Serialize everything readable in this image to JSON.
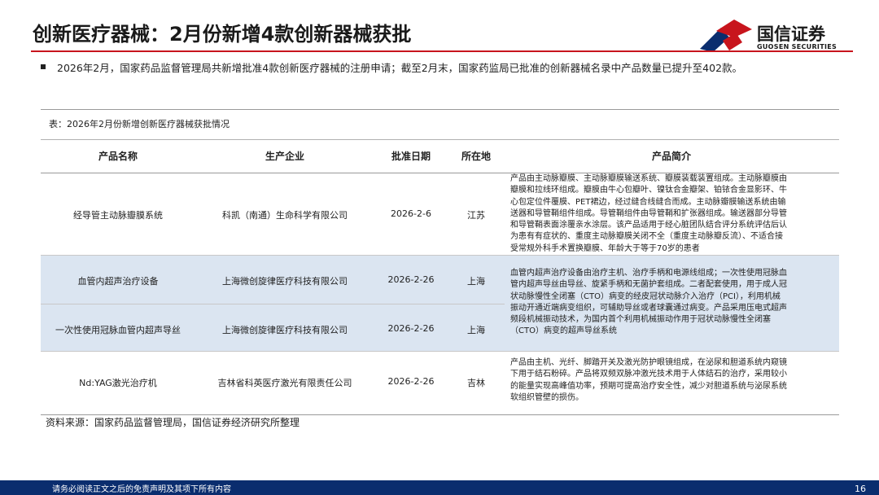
{
  "header": {
    "title": "创新医疗器械：2月份新增4款创新器械获批",
    "logo_cn": "国信证券",
    "logo_en": "GUOSEN SECURITIES",
    "accent_color": "#c8151d"
  },
  "bullet": "2026年2月，国家药品监督管理局共新增批准4款创新医疗器械的注册申请；截至2月末，国家药监局已批准的创新器械名录中产品数量已提升至402款。",
  "table": {
    "caption": "表：2026年2月份新增创新医疗器械获批情况",
    "headers": [
      "产品名称",
      "生产企业",
      "批准日期",
      "所在地",
      "产品简介"
    ],
    "rows": [
      {
        "name": "经导管主动脉瓣膜系统",
        "company": "科凯（南通）生命科学有限公司",
        "date": "2026-2-6",
        "location": "江苏"
      },
      {
        "name": "血管内超声治疗设备",
        "company": "上海微创旋律医疗科技有限公司",
        "date": "2026-2-26",
        "location": "上海"
      },
      {
        "name": "一次性使用冠脉血管内超声导丝",
        "company": "上海微创旋律医疗科技有限公司",
        "date": "2026-2-26",
        "location": "上海"
      },
      {
        "name": "Nd:YAG激光治疗机",
        "company": "吉林省科英医疗激光有限责任公司",
        "date": "2026-2-26",
        "location": "吉林"
      }
    ],
    "descriptions": [
      [
        "产品由主动脉瓣膜、主动脉瓣膜输送系统、瓣膜装载装置组成。主动脉瓣膜由",
        "瓣膜和拉线环组成。瓣膜由牛心包瓣叶、镍钛合金瓣架、铂铱合金显影环、牛",
        "心包定位件覆膜、PET裙边，经过缝合线缝合而成。主动脉瓣膜输送系统由输",
        "送器和导管鞘组件组成。导管鞘组件由导管鞘和扩张器组成。输送器部分导管",
        "和导管鞘表面涂覆亲水涂层。该产品适用于经心脏团队结合评分系统评估后认",
        "为患有有症状的、重度主动脉瓣膜关闭不全（重度主动脉瓣反流）、不适合接",
        "受常规外科手术置换瓣膜、年龄大于等于70岁的患者"
      ],
      [
        "血管内超声治疗设备由治疗主机、治疗手柄和电源线组成；一次性使用冠脉血",
        "管内超声导丝由导丝、旋紧手柄和无菌护套组成。二者配套使用，用于成人冠",
        "状动脉慢性全闭塞（CTO）病变的经皮冠状动脉介入治疗（PCI），利用机械",
        "振动开通近端病变组织，可辅助导丝或者球囊通过病变。产品采用压电式超声",
        "频段机械振动技术，为国内首个利用机械振动作用于冠状动脉慢性全闭塞",
        "（CTO）病变的超声导丝系统"
      ],
      [
        "产品由主机、光纤、脚踏开关及激光防护眼镜组成，在泌尿和胆道系统内窥镜",
        "下用于结石粉碎。产品将双频双脉冲激光技术用于人体结石的治疗，采用较小",
        "的能量实现高峰值功率，预期可提高治疗安全性，减少对胆道系统与泌尿系统",
        "软组织管壁的损伤。"
      ]
    ],
    "highlight_color": "#dbe5f1"
  },
  "source": "资料来源：国家药品监督管理局，国信证券经济研究所整理",
  "footer": {
    "disclaimer": "请务必阅读正文之后的免责声明及其项下所有内容",
    "page": "16",
    "bar_color": "#0a2d6e"
  }
}
